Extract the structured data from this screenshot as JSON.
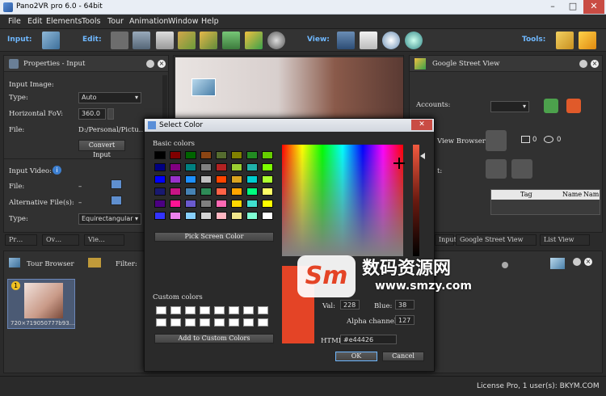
{
  "window": {
    "title": "Pano2VR pro 6.0 - 64bit"
  },
  "menu": [
    "File",
    "Edit",
    "Elements",
    "Tools",
    "Tour",
    "Animation",
    "Window",
    "Help"
  ],
  "toolbar": {
    "input_label": "Input:",
    "edit_label": "Edit:",
    "view_label": "View:",
    "tools_label": "Tools:"
  },
  "properties": {
    "title": "Properties - Input",
    "input_image": "Input Image:",
    "type_label": "Type:",
    "type_value": "Auto",
    "hfov_label": "Horizontal FoV:",
    "hfov_value": "360.0",
    "file_label": "File:",
    "file_value": "D:/Personal/Pictu…",
    "convert_button": "Convert Input",
    "input_video": "Input Video:",
    "video_file_label": "File:",
    "video_file_value": "–",
    "alt_files_label": "Alternative File(s):",
    "alt_files_value": "–",
    "video_type_label": "Type:",
    "video_type_value": "Equirectangular"
  },
  "street_view": {
    "title": "Google Street View",
    "accounts_label": "Accounts:",
    "view_browser_label": "View Browser:",
    "photos_count": "0",
    "views_count": "0",
    "table_headers": [
      "Tag",
      "Name",
      "Nam"
    ],
    "partial_label": "t:"
  },
  "bottom_tabs_left": [
    "Pr…",
    "Ov…",
    "Vie…"
  ],
  "bottom_tabs_right": [
    "Input",
    "Google Street View",
    "List View"
  ],
  "tour_browser": {
    "title": "Tour Browser",
    "filter_label": "Filter:",
    "node_badge": "1",
    "node_caption": "720×719050777b93…"
  },
  "dialog": {
    "title": "Select Color",
    "basic_label": "Basic colors",
    "pick_button": "Pick Screen Color",
    "custom_label": "Custom colors",
    "add_button": "Add to Custom Colors",
    "val_label": "Val:",
    "val_value": "228",
    "blue_label": "Blue:",
    "blue_value": "38",
    "alpha_label": "Alpha channel:",
    "alpha_value": "127",
    "html_label": "HTML:",
    "html_value": "#e44426",
    "ok_button": "OK",
    "cancel_button": "Cancel",
    "current_color": "#e44426"
  },
  "basic_colors": [
    "#000000",
    "#800000",
    "#006400",
    "#8b4513",
    "#556b2f",
    "#808000",
    "#228b22",
    "#66cd00",
    "#000080",
    "#800080",
    "#008080",
    "#808080",
    "#b22222",
    "#9acd32",
    "#20b2aa",
    "#7cfc00",
    "#0000ff",
    "#9932cc",
    "#1e90ff",
    "#c0c0c0",
    "#ff4500",
    "#daa520",
    "#00ced1",
    "#adff2f",
    "#191970",
    "#c71585",
    "#4682b4",
    "#2e8b57",
    "#ff6347",
    "#ffa500",
    "#00ff7f",
    "#ffff66",
    "#4b0082",
    "#ff1493",
    "#6a5acd",
    "#808080",
    "#ff69b4",
    "#ffd700",
    "#40e0d0",
    "#ffff00",
    "#3333ff",
    "#ee82ee",
    "#87cefa",
    "#d3d3d3",
    "#ffb6c1",
    "#f0e68c",
    "#7fffd4",
    "#ffffff"
  ],
  "watermark": {
    "main": "数码资源网",
    "url": "www.smzy.com"
  },
  "status": {
    "license": "License Pro, 1 user(s): BKYM.COM"
  }
}
